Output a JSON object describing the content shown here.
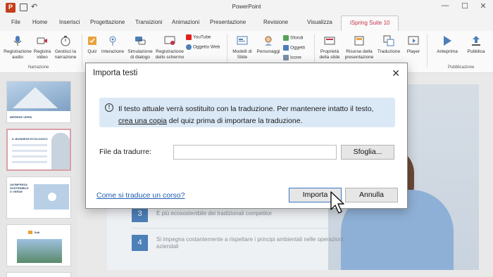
{
  "app": {
    "title": "PowerPoint"
  },
  "window_controls": {
    "minimize": "—",
    "maximize": "☐",
    "close": "✕"
  },
  "tabs": [
    {
      "label": "File"
    },
    {
      "label": "Home"
    },
    {
      "label": "Inserisci"
    },
    {
      "label": "Progettazione"
    },
    {
      "label": "Transizioni"
    },
    {
      "label": "Animazioni"
    },
    {
      "label": "Presentazione"
    },
    {
      "label": "Revisione"
    },
    {
      "label": "Visualizza"
    },
    {
      "label": "iSpring Suite 10"
    }
  ],
  "ribbon": {
    "narrazione": {
      "group_label": "Narrazione",
      "items": [
        "Registrazione audio",
        "Registra video",
        "Gestisci la narrazione"
      ]
    },
    "quiz_group": {
      "items": [
        "Quiz",
        "Interazione",
        "Simulazione di dialogo",
        "Registrazione dello schermo"
      ],
      "small": [
        "YouTube",
        "Oggetto Web"
      ]
    },
    "content_group": {
      "items": [
        "Modelli di Slide",
        "Personaggi"
      ],
      "small": [
        "Sfondi",
        "Oggetti",
        "Icone"
      ]
    },
    "pres_group": {
      "items": [
        "Proprietà della slide",
        "Risorse della presentazione",
        "Traduzione",
        "Player"
      ]
    },
    "pub_group": {
      "group_label": "Pubblicazione",
      "items": [
        "Anteprima",
        "Pubblica"
      ]
    },
    "accent_color": "#c4314b"
  },
  "thumbnails": [
    {
      "title": "IMPRESE VERDI"
    },
    {
      "title": "IL BUSINESS ECOLOGICO"
    },
    {
      "title": "UN'IMPRESA SOSTENIBILE O VERDE"
    },
    {
      "title": "Tutti"
    }
  ],
  "slide": {
    "items": [
      {
        "number": "3",
        "text": "È più ecosostenibile dei tradizionali competitor"
      },
      {
        "number": "4",
        "text": "Si impegna costantemente a rispettare i principi ambientali nelle operazioni aziendali"
      }
    ]
  },
  "dialog": {
    "title": "Importa testi",
    "close_glyph": "✕",
    "info": {
      "text_before": "Il testo attuale verrà sostituito con la traduzione. Per mantenere intatto il testo,",
      "link": "crea una copia",
      "text_after": " del quiz prima di importare la traduzione."
    },
    "file_label": "File da tradurre:",
    "file_value": "",
    "browse_button": "Sfoglia...",
    "help_link": "Come si traduce un corso?",
    "import_button": "Importa",
    "cancel_button": "Annulla"
  }
}
